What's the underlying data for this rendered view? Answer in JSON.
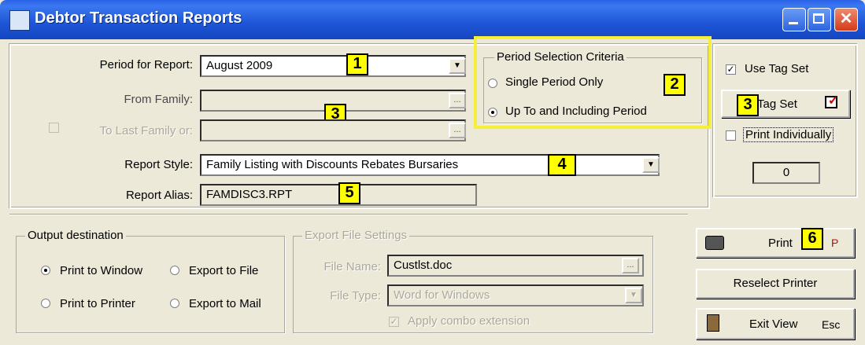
{
  "window": {
    "title": "Debtor Transaction Reports",
    "close_glyph": "✕"
  },
  "form": {
    "period_label": "Period for Report:",
    "period_value": "August 2009",
    "from_family_label": "From Family:",
    "from_family_value": "",
    "to_last_family_label": "To Last Family or:",
    "to_last_family_value": "",
    "report_style_label": "Report Style:",
    "report_style_value": "Family Listing with Discounts  Rebates Bursaries",
    "report_alias_label": "Report Alias:",
    "report_alias_value": "FAMDISC3.RPT",
    "dots": "..."
  },
  "period_criteria": {
    "title": "Period Selection Criteria",
    "options": [
      "Single Period Only",
      "Up To and Including Period"
    ],
    "selected": 1
  },
  "tags": {
    "use_tag_set_label": "Use Tag Set",
    "use_tag_set_checked": true,
    "tag_set_button": "Tag Set",
    "print_individually_label": "Print Individually",
    "print_individually_checked": false,
    "count": "0"
  },
  "output": {
    "title": "Output destination",
    "options": [
      "Print to Window",
      "Export to File",
      "Print to Printer",
      "Export to Mail"
    ],
    "selected": 0
  },
  "export": {
    "title": "Export  File Settings",
    "file_name_label": "File Name:",
    "file_name_value": "Custlst.doc",
    "file_type_label": "File Type:",
    "file_type_value": "Word for Windows",
    "apply_combo_label": "Apply combo extension",
    "apply_combo_checked": true
  },
  "buttons": {
    "print_label": "Print",
    "print_shortcut": "P",
    "reselect_printer": "Reselect Printer",
    "exit_view": "Exit View",
    "exit_shortcut": "Esc"
  },
  "badges": [
    "1",
    "2",
    "3",
    "3",
    "4",
    "5",
    "6"
  ],
  "colors": {
    "titlebar": "#2a62e8",
    "badge": "#ffff00",
    "highlight_box": "#f5ef3a",
    "shortcut_red": "#d40000"
  }
}
